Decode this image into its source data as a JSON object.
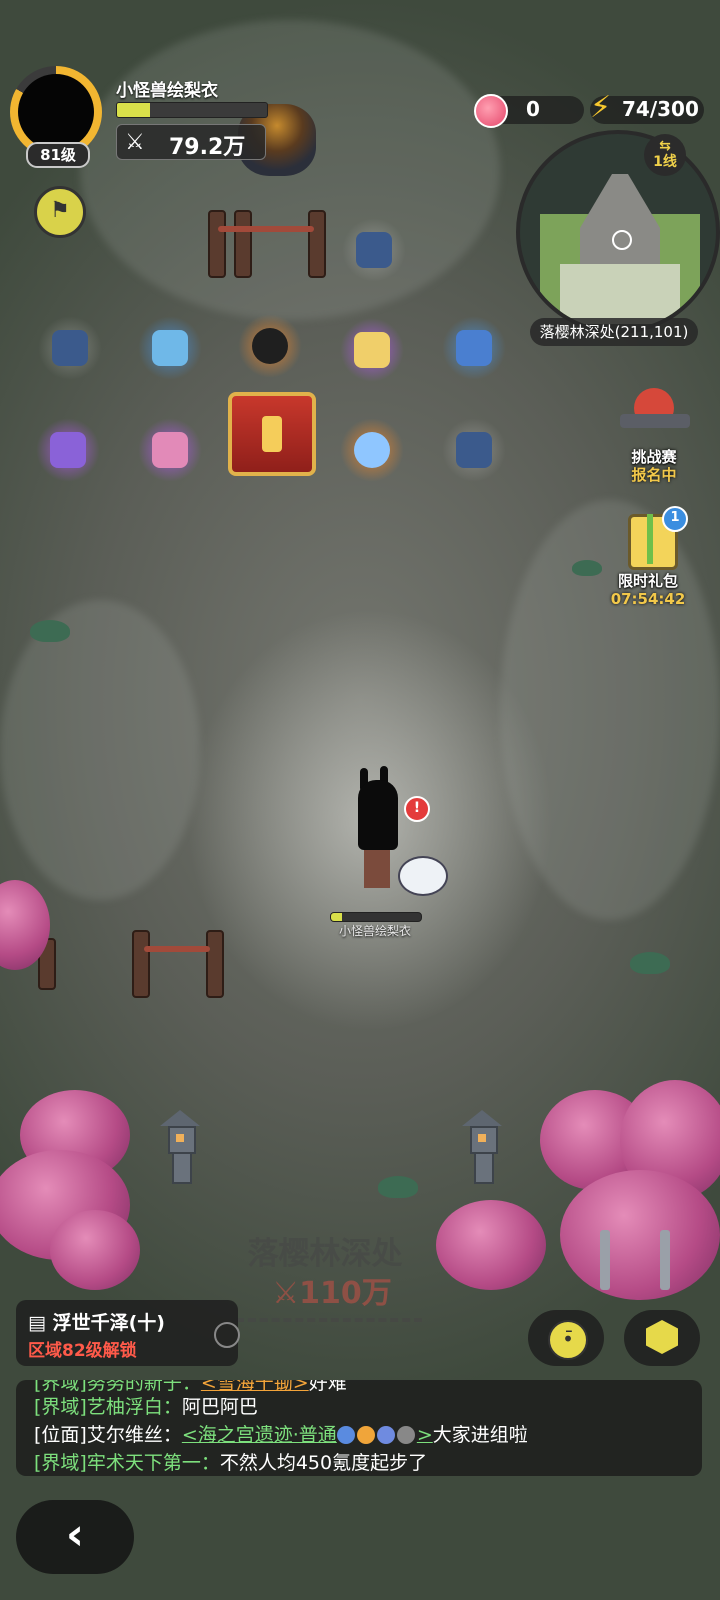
{
  "player": {
    "name": "小怪兽绘梨衣",
    "level": "81级",
    "power": "79.2万",
    "hp_fraction": 0.22
  },
  "resources": {
    "peach": "0",
    "energy": "74/300"
  },
  "minimap": {
    "line": "1线",
    "location": "落樱林深处(211,101)"
  },
  "side_buttons": {
    "challenge": {
      "label": "挑战赛",
      "status": "报名中"
    },
    "gift": {
      "label": "限时礼包",
      "timer": "07:54:42",
      "badge": "1"
    }
  },
  "character": {
    "name": "小怪兽绘梨衣",
    "hp_fraction": 0.12,
    "alert": "!"
  },
  "zone": {
    "name": "落樱林深处",
    "power": "110万"
  },
  "quest": {
    "title": "浮世千泽(十)",
    "subtitle": "区域82级解锁"
  },
  "chat": {
    "lines": [
      {
        "channel": "[界域]",
        "sender": "努努的新子：",
        "message": "<雪海千锄>",
        "tail": "好难"
      },
      {
        "channel": "[界域]",
        "sender": "艺柚浮白：",
        "message": "阿巴阿巴"
      },
      {
        "channel": "[位面]",
        "sender": "艾尔维丝：",
        "message": "<海之宫遗迹·普通",
        "link_end": ">",
        "tail": "大家进组啦"
      },
      {
        "channel": "[界域]",
        "sender": "牢术天下第一：",
        "message": "不然人均450氪度起步了"
      }
    ]
  },
  "icons": {
    "power": "crossed-swords-icon",
    "energy": "lightning-icon",
    "peach": "peach-icon",
    "back": "chevron-left-icon"
  },
  "colors": {
    "accent_yellow": "#f2b631",
    "chat_green": "#7de07d",
    "warning_red": "#ff5a4a"
  }
}
